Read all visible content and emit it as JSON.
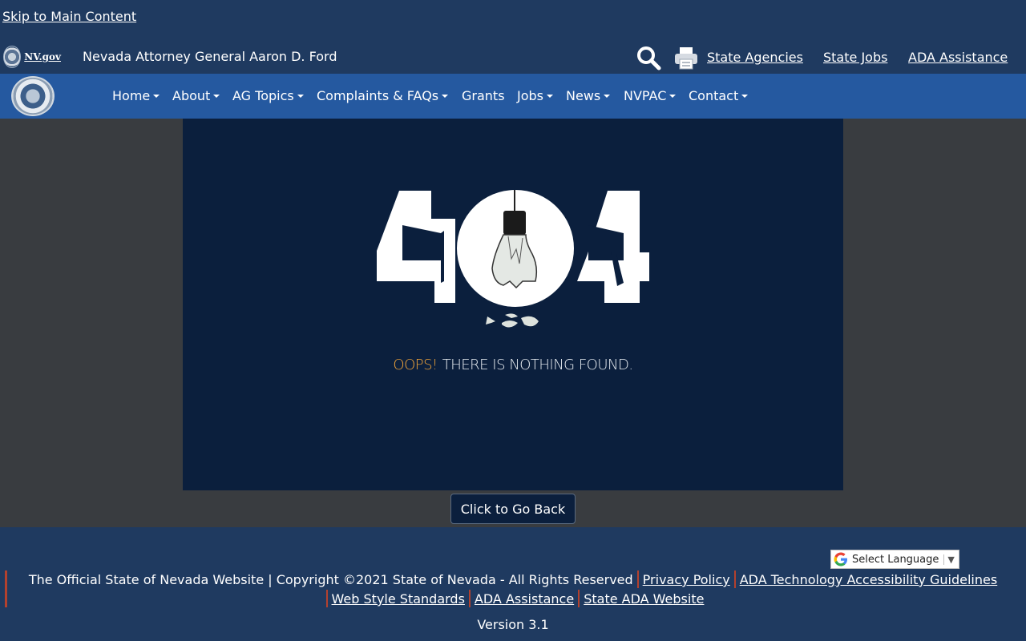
{
  "skip_link": "Skip to Main Content",
  "header": {
    "nvgov_logo_text": "NV.gov",
    "site_title": "Nevada Attorney General Aaron D. Ford",
    "links": [
      "State Agencies",
      "State Jobs",
      "ADA Assistance"
    ]
  },
  "nav": {
    "items": [
      {
        "label": "Home",
        "dropdown": true
      },
      {
        "label": "About",
        "dropdown": true
      },
      {
        "label": "AG Topics",
        "dropdown": true
      },
      {
        "label": "Complaints & FAQs",
        "dropdown": true
      },
      {
        "label": "Grants",
        "dropdown": false
      },
      {
        "label": "Jobs",
        "dropdown": true
      },
      {
        "label": "News",
        "dropdown": true
      },
      {
        "label": "NVPAC",
        "dropdown": true
      },
      {
        "label": "Contact",
        "dropdown": true
      }
    ]
  },
  "error": {
    "code": "404",
    "oops": "OOPS!",
    "message": "THERE IS NOTHING FOUND.",
    "back_button": "Click to Go Back"
  },
  "footer": {
    "language_select": "Select Language",
    "copyright": "The Official State of Nevada Website | Copyright ©2021 State of Nevada - All Rights Reserved",
    "links": [
      "Privacy Policy",
      "ADA Technology Accessibility Guidelines",
      "Web Style Standards",
      "ADA Assistance",
      "State ADA Website"
    ],
    "version": "Version 3.1"
  },
  "colors": {
    "header_bg": "#1f3a60",
    "nav_bg": "#2559a0",
    "panel_bg": "#0b1f3d",
    "content_bg": "#393c40",
    "accent_orange": "#f0a43a",
    "separator_red": "#b3412e"
  },
  "icons": [
    "search-icon",
    "print-icon",
    "chevron-down-icon",
    "google-icon"
  ]
}
